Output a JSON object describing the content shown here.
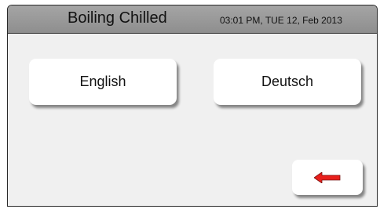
{
  "header": {
    "title": "Boiling Chilled",
    "datetime": "03:01 PM, TUE 12, Feb 2013"
  },
  "languages": [
    {
      "label": "English"
    },
    {
      "label": "Deutsch"
    }
  ],
  "back_button": {
    "icon": "left-arrow-icon",
    "arrow_color": "#e8201c"
  },
  "colors": {
    "header_bg": "#999999",
    "screen_bg": "#f0f0f0",
    "button_bg": "#ffffff"
  }
}
